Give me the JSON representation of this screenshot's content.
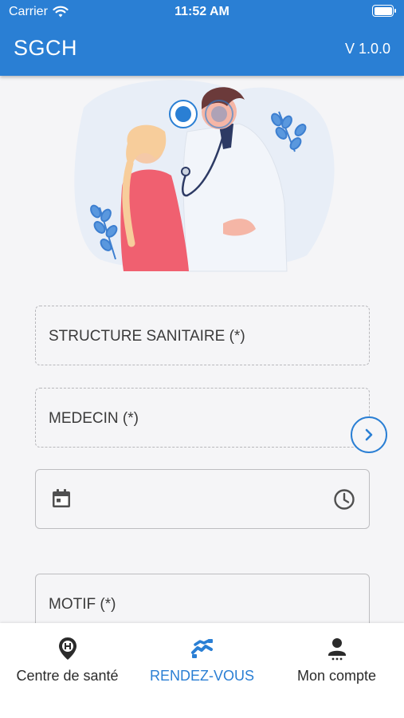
{
  "status_bar": {
    "carrier": "Carrier",
    "time": "11:52 AM"
  },
  "app_bar": {
    "title": "SGCH",
    "version": "V 1.0.0"
  },
  "form": {
    "structure_label": "STRUCTURE SANITAIRE (*)",
    "medecin_label": "MEDECIN (*)",
    "motif_label": "MOTIF (*)"
  },
  "bottom_nav": {
    "items": [
      {
        "label": "Centre de santé",
        "icon": "hospital-pin-icon",
        "active": false
      },
      {
        "label": "RENDEZ-VOUS",
        "icon": "handshake-icon",
        "active": true
      },
      {
        "label": "Mon compte",
        "icon": "person-icon",
        "active": false
      }
    ]
  },
  "colors": {
    "primary": "#2a7fd4",
    "background": "#f5f5f7",
    "text": "#3b3b3b"
  }
}
